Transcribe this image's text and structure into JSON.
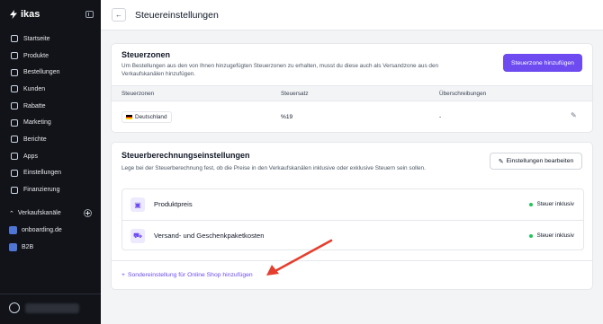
{
  "sidebar": {
    "brand": "ikas",
    "items": [
      {
        "label": "Startseite",
        "icon": "home-icon"
      },
      {
        "label": "Produkte",
        "icon": "box-icon"
      },
      {
        "label": "Bestellungen",
        "icon": "cart-icon"
      },
      {
        "label": "Kunden",
        "icon": "users-icon"
      },
      {
        "label": "Rabatte",
        "icon": "percent-icon"
      },
      {
        "label": "Marketing",
        "icon": "megaphone-icon"
      },
      {
        "label": "Berichte",
        "icon": "chart-icon"
      },
      {
        "label": "Apps",
        "icon": "apps-icon"
      },
      {
        "label": "Einstellungen",
        "icon": "gear-icon"
      },
      {
        "label": "Finanzierung",
        "icon": "finance-icon"
      }
    ],
    "sales_channels_label": "Verkaufskanäle",
    "channels": [
      {
        "label": "onboarding.de"
      },
      {
        "label": "B2B"
      }
    ]
  },
  "header": {
    "title": "Steuereinstellungen"
  },
  "tax_zones": {
    "title": "Steuerzonen",
    "description": "Um Bestellungen aus den von Ihnen hinzugefügten Steuerzonen zu erhalten, musst du diese auch als Versandzone aus den Verkaufskanälen hinzufügen.",
    "add_button": "Steuerzone hinzufügen",
    "columns": [
      "Steuerzonen",
      "Steuersatz",
      "Überschreibungen"
    ],
    "rows": [
      {
        "zone": "Deutschland",
        "rate": "%19",
        "overrides": "-"
      }
    ]
  },
  "tax_calc": {
    "title": "Steuerberechnungseinstellungen",
    "description": "Lege bei der Steuerberechnung fest, ob die Preise in den Verkaufskanälen inklusive oder exklusive Steuern sein sollen.",
    "edit_button": "Einstellungen bearbeiten",
    "items": [
      {
        "label": "Produktpreis",
        "status": "Steuer inklusiv"
      },
      {
        "label": "Versand- und Geschenkpaketkosten",
        "status": "Steuer inklusiv"
      }
    ],
    "custom_link": "Sondereinstellung für Online Shop hinzufügen"
  },
  "colors": {
    "accent": "#6d4bf0",
    "sidebar_bg": "#111318",
    "status_dot": "#22c55e",
    "annotation_arrow": "#e53e2e"
  }
}
